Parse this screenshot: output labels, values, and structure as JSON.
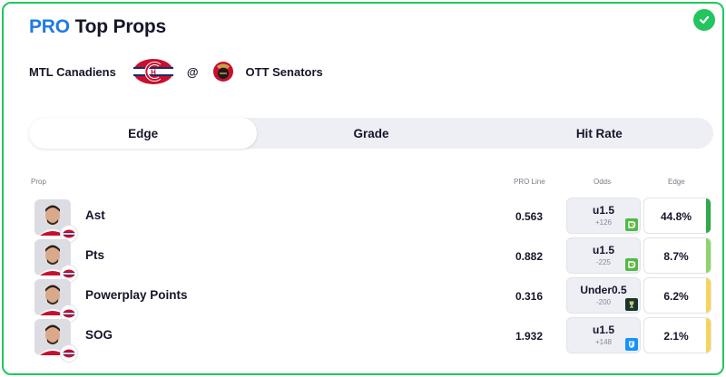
{
  "header": {
    "title_pro": "PRO",
    "title_rest": "Top Props"
  },
  "matchup": {
    "home": "MTL Canadiens",
    "separator": "@",
    "away": "OTT Senators"
  },
  "tabs": [
    {
      "label": "Edge",
      "active": true
    },
    {
      "label": "Grade",
      "active": false
    },
    {
      "label": "Hit Rate",
      "active": false
    }
  ],
  "columns": {
    "prop": "Prop",
    "pro_line": "PRO Line",
    "odds": "Odds",
    "edge": "Edge"
  },
  "rows": [
    {
      "prop": "Ast",
      "pro_line": "0.563",
      "odds_line": "u1.5",
      "odds_price": "+126",
      "book": "draftkings",
      "edge": "44.8%",
      "edge_color": "#2eaa4a"
    },
    {
      "prop": "Pts",
      "pro_line": "0.882",
      "odds_line": "u1.5",
      "odds_price": "-225",
      "book": "draftkings",
      "edge": "8.7%",
      "edge_color": "#8fd46a"
    },
    {
      "prop": "Powerplay Points",
      "pro_line": "0.316",
      "odds_line": "Under0.5",
      "odds_price": "-200",
      "book": "stanley-cup",
      "edge": "6.2%",
      "edge_color": "#f5d45a"
    },
    {
      "prop": "SOG",
      "pro_line": "1.932",
      "odds_line": "u1.5",
      "odds_price": "+148",
      "book": "fanduel",
      "edge": "2.1%",
      "edge_color": "#f5d45a"
    }
  ],
  "colors": {
    "accent": "#1e7be6",
    "border": "#22c55e",
    "canadiens_red": "#c8102e",
    "canadiens_blue": "#1a2a6c"
  }
}
